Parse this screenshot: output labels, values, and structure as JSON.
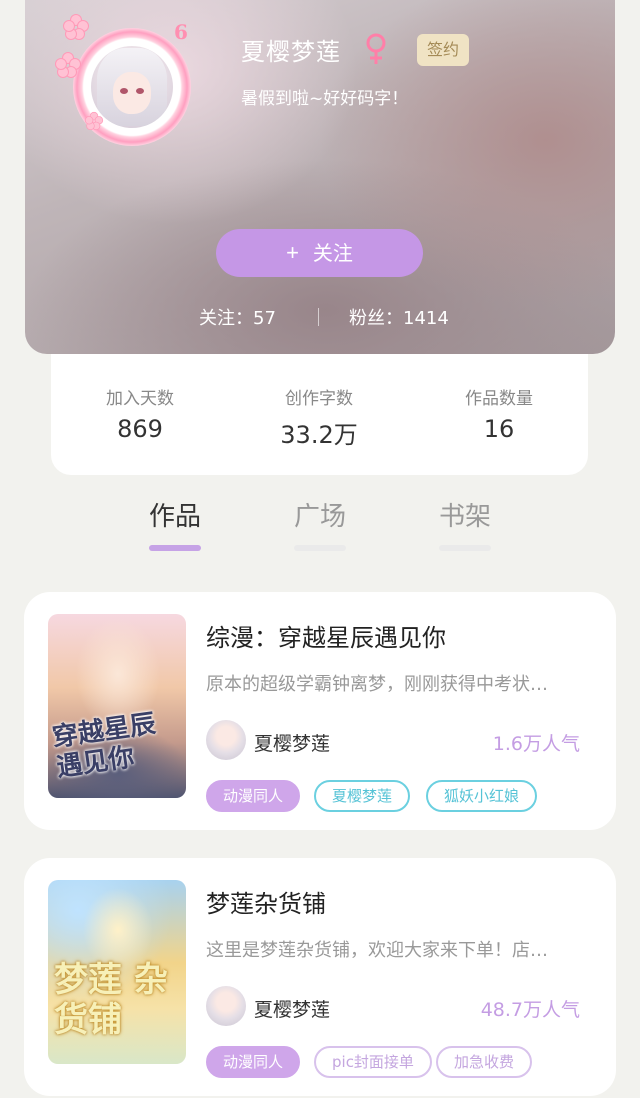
{
  "profile": {
    "name": "夏樱梦莲",
    "level": "6",
    "gender_symbol": "♀",
    "badge": "签约",
    "signature": "暑假到啦~好好码字！",
    "follow_button": "关注",
    "follow_plus": "+",
    "following_label": "关注：57",
    "fans_label": "粉丝：1414"
  },
  "stats": [
    {
      "label": "加入天数",
      "value": "869"
    },
    {
      "label": "创作字数",
      "value": "33.2万"
    },
    {
      "label": "作品数量",
      "value": "16"
    }
  ],
  "tabs": [
    {
      "label": "作品",
      "active": true
    },
    {
      "label": "广场",
      "active": false
    },
    {
      "label": "书架",
      "active": false
    }
  ],
  "books": [
    {
      "cover_text": "穿越星辰 遇见你",
      "title": "综漫：穿越星辰遇见你",
      "description": "原本的超级学霸钟离梦，刚刚获得中考状…",
      "author": "夏樱梦莲",
      "popularity": "1.6万人气",
      "tags": [
        "动漫同人",
        "夏樱梦莲",
        "狐妖小红娘"
      ]
    },
    {
      "cover_text": "梦莲 杂货铺",
      "title": "梦莲杂货铺",
      "description": "这里是梦莲杂货铺，欢迎大家来下单！店…",
      "author": "夏樱梦莲",
      "popularity": "48.7万人气",
      "tags": [
        "动漫同人",
        "pic封面接单",
        "加急收费"
      ]
    }
  ],
  "colors": {
    "accent": "#c597e6",
    "tab_indicator": "#c6a3e6",
    "popularity": "#c49de3",
    "tag_cyan": "#6bd0e0",
    "gender": "#ff7fa8"
  }
}
